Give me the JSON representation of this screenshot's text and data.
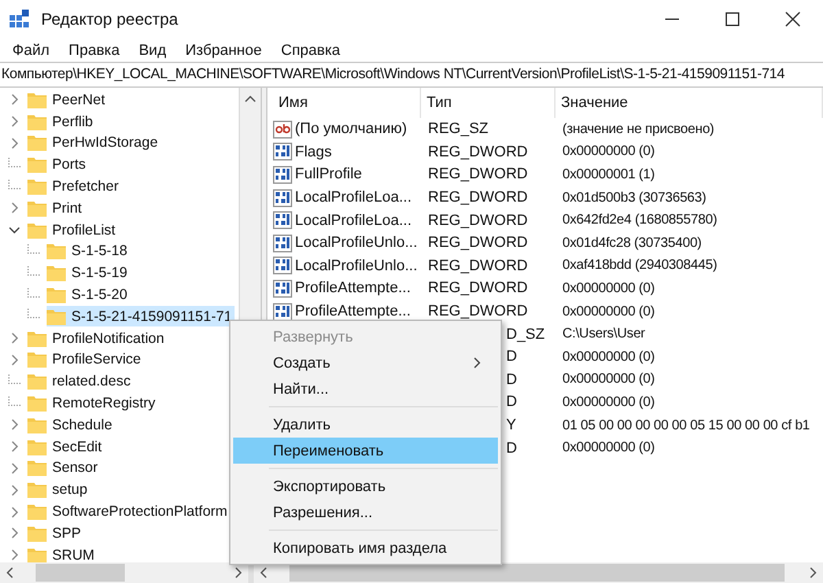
{
  "window": {
    "title": "Редактор реестра"
  },
  "menu_bar": [
    "Файл",
    "Правка",
    "Вид",
    "Избранное",
    "Справка"
  ],
  "address": "Компьютер\\HKEY_LOCAL_MACHINE\\SOFTWARE\\Microsoft\\Windows NT\\CurrentVersion\\ProfileList\\S-1-5-21-4159091151-714",
  "tree": [
    {
      "label": "PeerNet",
      "kind": "branch",
      "expanded": false,
      "selected": false
    },
    {
      "label": "Perflib",
      "kind": "branch",
      "expanded": false,
      "selected": false
    },
    {
      "label": "PerHwIdStorage",
      "kind": "branch",
      "expanded": false,
      "selected": false
    },
    {
      "label": "Ports",
      "kind": "leaf",
      "selected": false
    },
    {
      "label": "Prefetcher",
      "kind": "leaf",
      "selected": false
    },
    {
      "label": "Print",
      "kind": "branch",
      "expanded": false,
      "selected": false
    },
    {
      "label": "ProfileList",
      "kind": "branch",
      "expanded": true,
      "selected": false,
      "children": [
        {
          "label": "S-1-5-18",
          "kind": "leaf",
          "selected": false
        },
        {
          "label": "S-1-5-19",
          "kind": "leaf",
          "selected": false
        },
        {
          "label": "S-1-5-20",
          "kind": "leaf",
          "selected": false
        },
        {
          "label": "S-1-5-21-4159091151-71",
          "kind": "leaf",
          "selected": true
        }
      ]
    },
    {
      "label": "ProfileNotification",
      "kind": "branch",
      "expanded": false,
      "selected": false
    },
    {
      "label": "ProfileService",
      "kind": "branch",
      "expanded": false,
      "selected": false
    },
    {
      "label": "related.desc",
      "kind": "leaf",
      "selected": false
    },
    {
      "label": "RemoteRegistry",
      "kind": "leaf",
      "selected": false
    },
    {
      "label": "Schedule",
      "kind": "branch",
      "expanded": false,
      "selected": false
    },
    {
      "label": "SecEdit",
      "kind": "branch",
      "expanded": false,
      "selected": false
    },
    {
      "label": "Sensor",
      "kind": "branch",
      "expanded": false,
      "selected": false
    },
    {
      "label": "setup",
      "kind": "branch",
      "expanded": false,
      "selected": false
    },
    {
      "label": "SoftwareProtectionPlatform",
      "kind": "branch",
      "expanded": false,
      "selected": false
    },
    {
      "label": "SPP",
      "kind": "branch",
      "expanded": false,
      "selected": false
    },
    {
      "label": "SRUM",
      "kind": "branch",
      "expanded": false,
      "selected": false
    }
  ],
  "values": {
    "columns": [
      "Имя",
      "Тип",
      "Значение"
    ],
    "rows": [
      {
        "kind": "string",
        "name": "(По умолчанию)",
        "type": "REG_SZ",
        "value": "(значение не присвоено)"
      },
      {
        "kind": "dword",
        "name": "Flags",
        "type": "REG_DWORD",
        "value": "0x00000000 (0)"
      },
      {
        "kind": "dword",
        "name": "FullProfile",
        "type": "REG_DWORD",
        "value": "0x00000001 (1)"
      },
      {
        "kind": "dword",
        "name": "LocalProfileLoa...",
        "type": "REG_DWORD",
        "value": "0x01d500b3 (30736563)"
      },
      {
        "kind": "dword",
        "name": "LocalProfileLoa...",
        "type": "REG_DWORD",
        "value": "0x642fd2e4 (1680855780)"
      },
      {
        "kind": "dword",
        "name": "LocalProfileUnlo...",
        "type": "REG_DWORD",
        "value": "0x01d4fc28 (30735400)"
      },
      {
        "kind": "dword",
        "name": "LocalProfileUnlo...",
        "type": "REG_DWORD",
        "value": "0xaf418bdd (2940308445)"
      },
      {
        "kind": "dword",
        "name": "ProfileAttempte...",
        "type": "REG_DWORD",
        "value": "0x00000000 (0)"
      },
      {
        "kind": "dword",
        "name": "ProfileAttempte...",
        "type": "REG_DWORD",
        "value": "0x00000000 (0)"
      },
      {
        "kind": "hidden",
        "type": "D_SZ",
        "value": "C:\\Users\\User"
      },
      {
        "kind": "hidden",
        "type": "D",
        "value": "0x00000000 (0)"
      },
      {
        "kind": "hidden",
        "type": "D",
        "value": "0x00000000 (0)"
      },
      {
        "kind": "hidden",
        "type": "D",
        "value": "0x00000000 (0)"
      },
      {
        "kind": "hidden",
        "type": "Y",
        "value": "01 05 00 00 00 00 00 05 15 00 00 00 cf b1"
      },
      {
        "kind": "hidden",
        "type": "D",
        "value": "0x00000000 (0)"
      }
    ]
  },
  "context_menu": [
    {
      "kind": "item",
      "label": "Развернуть",
      "disabled": true,
      "selected": false
    },
    {
      "kind": "submenu",
      "label": "Создать",
      "disabled": false,
      "selected": false
    },
    {
      "kind": "item",
      "label": "Найти...",
      "disabled": false,
      "selected": false
    },
    {
      "kind": "separator"
    },
    {
      "kind": "item",
      "label": "Удалить",
      "disabled": false,
      "selected": false
    },
    {
      "kind": "item",
      "label": "Переименовать",
      "disabled": false,
      "selected": true
    },
    {
      "kind": "separator"
    },
    {
      "kind": "item",
      "label": "Экспортировать",
      "disabled": false,
      "selected": false
    },
    {
      "kind": "item",
      "label": "Разрешения...",
      "disabled": false,
      "selected": false
    },
    {
      "kind": "separator"
    },
    {
      "kind": "item",
      "label": "Копировать имя раздела",
      "disabled": false,
      "selected": false
    }
  ]
}
